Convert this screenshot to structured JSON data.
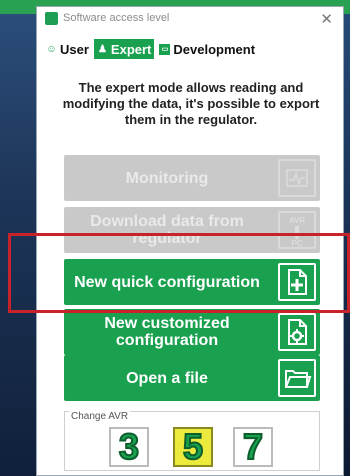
{
  "window": {
    "title": "Software access level",
    "close_glyph": "✕"
  },
  "tabs": [
    {
      "label": "User",
      "icon": "user-icon",
      "active": false
    },
    {
      "label": "Expert",
      "icon": "expert-icon",
      "active": true
    },
    {
      "label": "Development",
      "icon": "development-icon",
      "active": false
    }
  ],
  "description": "The expert mode allows reading and modifying the data, it's possible to export them in the regulator.",
  "buttons": {
    "monitoring": {
      "label": "Monitoring",
      "enabled": false,
      "icon": "monitoring-icon"
    },
    "download": {
      "label": "Download data from regulator",
      "enabled": false,
      "icon": "avr-to-pc-icon",
      "icon_text_top": "AVR",
      "icon_text_bottom": "PC"
    },
    "new_quick": {
      "label": "New quick configuration",
      "enabled": true,
      "icon": "new-file-plus-icon"
    },
    "new_custom": {
      "label": "New customized configuration",
      "enabled": true,
      "icon": "new-file-gear-icon"
    },
    "open_file": {
      "label": "Open a file",
      "enabled": true,
      "icon": "open-folder-icon"
    }
  },
  "change_avr": {
    "label": "Change AVR",
    "options": [
      "3",
      "5",
      "7"
    ],
    "selected": "5"
  },
  "colors": {
    "accent_green": "#19a14f",
    "highlight_red": "#c8232b",
    "selected_yellow": "#ecea3c",
    "disabled_gray": "#c9c9c9"
  }
}
